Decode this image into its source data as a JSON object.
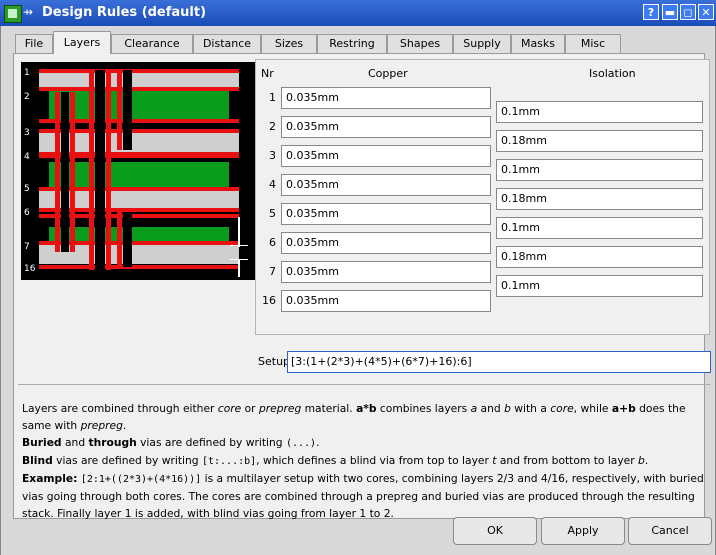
{
  "window": {
    "title": "Design Rules (default)"
  },
  "titlebar_buttons": [
    "?",
    "▬",
    "◻",
    "✕"
  ],
  "tabs": [
    {
      "label": "File",
      "w": 38
    },
    {
      "label": "Layers",
      "w": 58,
      "active": true
    },
    {
      "label": "Clearance",
      "w": 82
    },
    {
      "label": "Distance",
      "w": 68
    },
    {
      "label": "Sizes",
      "w": 56
    },
    {
      "label": "Restring",
      "w": 70
    },
    {
      "label": "Shapes",
      "w": 66
    },
    {
      "label": "Supply",
      "w": 58
    },
    {
      "label": "Masks",
      "w": 54
    },
    {
      "label": "Misc",
      "w": 56
    }
  ],
  "preview": {
    "layer_labels": [
      "1",
      "2",
      "3",
      "4",
      "5",
      "6",
      "7",
      "16"
    ]
  },
  "layers": {
    "header_nr": "Nr",
    "header_copper": "Copper",
    "header_isolation": "Isolation",
    "copper": [
      {
        "nr": "1",
        "value": "0.035mm"
      },
      {
        "nr": "2",
        "value": "0.035mm"
      },
      {
        "nr": "3",
        "value": "0.035mm"
      },
      {
        "nr": "4",
        "value": "0.035mm"
      },
      {
        "nr": "5",
        "value": "0.035mm"
      },
      {
        "nr": "6",
        "value": "0.035mm"
      },
      {
        "nr": "7",
        "value": "0.035mm"
      },
      {
        "nr": "16",
        "value": "0.035mm"
      }
    ],
    "isolation": [
      "0.1mm",
      "0.18mm",
      "0.1mm",
      "0.18mm",
      "0.1mm",
      "0.18mm",
      "0.1mm"
    ]
  },
  "setup": {
    "label": "Setup",
    "value": "[3:(1+(2*3)+(4*5)+(6*7)+16):6]"
  },
  "description": {
    "p1_a": "Layers are combined through either ",
    "p1_core": "core",
    "p1_b": " or ",
    "p1_prepreg": "prepreg",
    "p1_c": " material. ",
    "p1_ab": "a*b",
    "p1_d": " combines layers ",
    "p1_a_var": "a",
    "p1_e": " and ",
    "p1_b_var": "b",
    "p1_f": " with a ",
    "p1_core2": "core",
    "p1_g": ", while ",
    "p1_aplusb": "a+b",
    "p1_h": " does the same with ",
    "p1_prepreg2": "prepreg",
    "p1_i": ".",
    "p2_buried": "Buried",
    "p2_and": " and ",
    "p2_through": "through",
    "p2_rest": " vias are defined by writing ",
    "p2_code": "(...)",
    "p2_end": ".",
    "p3_blind": "Blind",
    "p3_a": " vias are defined by writing ",
    "p3_code": "[t:...:b]",
    "p3_b": ", which defines a blind via from top to layer ",
    "p3_t": "t",
    "p3_c": " and from bottom to layer ",
    "p3_bvar": "b",
    "p3_d": ".",
    "p4_example": "Example:",
    "p4_code": "[2:1+((2*3)+(4*16))]",
    "p4_rest": " is a multilayer setup with two cores, combining layers 2/3 and 4/16, respectively, with buried vias going through both cores. The cores are combined through a prepreg and buried vias are produced through the resulting stack. Finally layer 1 is added, with blind vias going from layer 1 to 2."
  },
  "buttons": {
    "ok": "OK",
    "apply": "Apply",
    "cancel": "Cancel"
  }
}
